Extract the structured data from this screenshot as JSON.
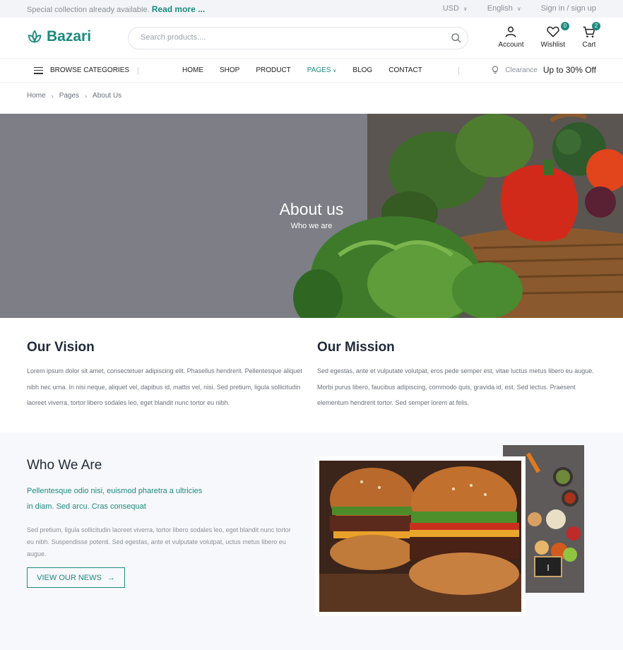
{
  "topbar": {
    "promo_text": "Special collection already available.",
    "promo_link": "Read more ...",
    "currency": "USD",
    "language": "English",
    "auth": "Sign in / sign up"
  },
  "header": {
    "brand": "Bazari",
    "search_placeholder": "Search products....",
    "account_label": "Account",
    "wishlist_label": "Wishlist",
    "wishlist_count": "0",
    "cart_label": "Cart",
    "cart_count": "2"
  },
  "nav": {
    "browse_label": "BROWSE CATEGORIES",
    "items": [
      {
        "label": "HOME"
      },
      {
        "label": "SHOP"
      },
      {
        "label": "PRODUCT"
      },
      {
        "label": "PAGES"
      },
      {
        "label": "BLOG"
      },
      {
        "label": "CONTACT"
      }
    ],
    "promo_label": "Clearance",
    "promo_value": "Up to 30% Off"
  },
  "breadcrumb": [
    "Home",
    "Pages",
    "About Us"
  ],
  "hero": {
    "title": "About us",
    "subtitle": "Who we are"
  },
  "vision": {
    "title": "Our Vision",
    "text": "Lorem ipsum dolor sit amet, consectetuer adipiscing elit. Phasellus hendrerit. Pellentesque aliquet nibh nec urna. In nisi neque, aliquet vel, dapibus id, mattis vel, nisi. Sed pretium, ligula sollicitudin laoreet viverra, tortor libero sodales leo, eget blandit nunc tortor eu nibh."
  },
  "mission": {
    "title": "Our Mission",
    "text": "Sed egestas, ante et vulputate volutpat, eros pede semper est, vitae luctus metus libero eu augue. Morbi purus libero, faucibus adipiscing, commodo quis, gravida id, est. Sed lectus. Praesent elementum hendrerit tortor. Sed semper lorem at felis."
  },
  "who": {
    "title": "Who We Are",
    "lead_line1": "Pellentesque odio nisi, euismod pharetra a ultricies",
    "lead_line2": "in diam. Sed arcu. Cras consequat",
    "text": "Sed pretium, ligula sollicitudin laoreet viverra, tortor libero sodales leo, eget blandit nunc tortor eu nibh. Suspendisse potenti. Sed egestas, ante et vulputate volutpat, uctus metus libero eu augue.",
    "button_label": "VIEW OUR NEWS"
  },
  "colors": {
    "accent": "#1d8a7e",
    "hero_overlay": "#7d7e86",
    "section_bg": "#f7f8fb"
  }
}
